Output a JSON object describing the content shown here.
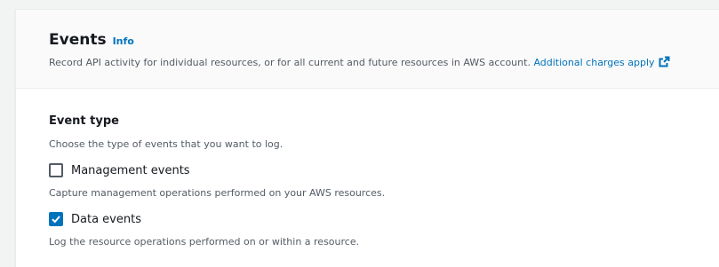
{
  "events_panel": {
    "title": "Events",
    "info_link": "Info",
    "description": "Record API activity for individual resources, or for all current and future resources in AWS account.",
    "charges_link": "Additional charges apply",
    "charges_link_icon": "external-link-icon"
  },
  "event_type": {
    "label": "Event type",
    "description": "Choose the type of events that you want to log.",
    "options": [
      {
        "label": "Management events",
        "checked": false,
        "description": "Capture management operations performed on your AWS resources."
      },
      {
        "label": "Data events",
        "checked": true,
        "description": "Log the resource operations performed on or within a resource."
      }
    ]
  },
  "colors": {
    "link": "#0073bb",
    "checkbox_checked": "#0073bb",
    "text_primary": "#16191f",
    "text_secondary": "#545b64"
  }
}
